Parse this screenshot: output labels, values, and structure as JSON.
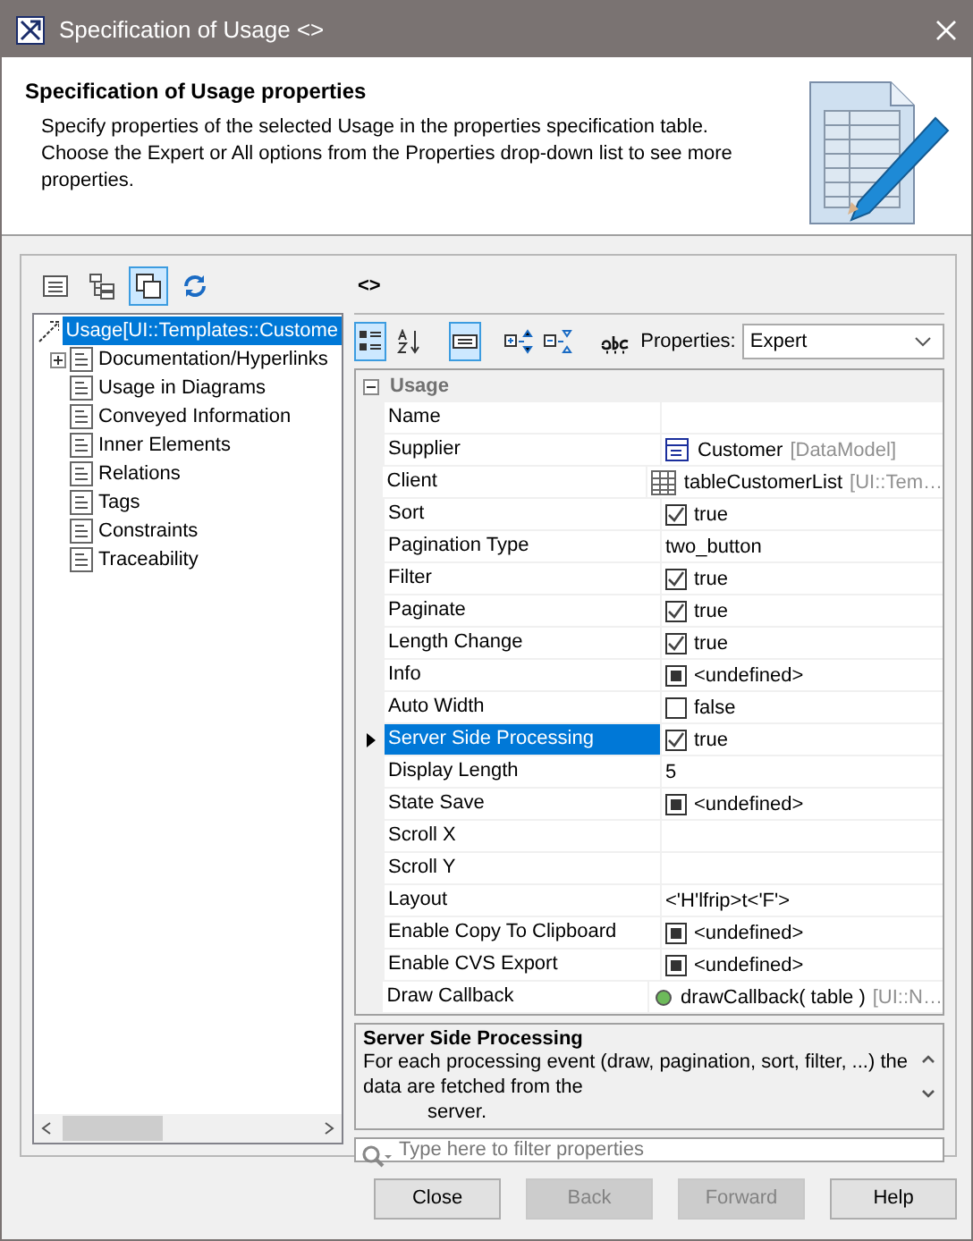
{
  "window": {
    "title": "Specification of Usage <>"
  },
  "header": {
    "title": "Specification of Usage properties",
    "description": "Specify properties of the selected Usage in the properties specification table. Choose the Expert or All options from the Properties drop-down list to see more properties."
  },
  "tree_toolbar": [
    {
      "kind": "list",
      "selected": false
    },
    {
      "kind": "tree",
      "selected": false
    },
    {
      "kind": "copy",
      "selected": true
    },
    {
      "kind": "refresh",
      "selected": false
    }
  ],
  "element_name": "<>",
  "tree": {
    "label": "Usage[UI::Templates::Custome",
    "selected": true,
    "children": [
      {
        "label": "Documentation/Hyperlinks",
        "selected": false,
        "expandable": true,
        "expanded": false
      },
      {
        "label": "Usage in Diagrams",
        "selected": false,
        "expandable": false
      },
      {
        "label": "Conveyed Information",
        "selected": false,
        "expandable": false
      },
      {
        "label": "Inner Elements",
        "selected": false,
        "expandable": false
      },
      {
        "label": "Relations",
        "selected": false,
        "expandable": false
      },
      {
        "label": "Tags",
        "selected": false,
        "expandable": false
      },
      {
        "label": "Constraints",
        "selected": false,
        "expandable": false
      },
      {
        "label": "Traceability",
        "selected": false,
        "expandable": false
      }
    ]
  },
  "grid_toolbar": [
    {
      "kind": "categorized",
      "selected": true
    },
    {
      "kind": "sort",
      "selected": false
    },
    {
      "kind": "description",
      "selected": true
    },
    {
      "kind": "expand",
      "selected": false
    },
    {
      "kind": "collapse",
      "selected": false
    },
    {
      "kind": "spelling",
      "selected": false
    }
  ],
  "properties_filter": {
    "label": "Properties:",
    "value": "Expert"
  },
  "group": {
    "label": "Usage",
    "expanded": true
  },
  "properties": [
    {
      "name": "Name",
      "kind": "text",
      "selected": false
    },
    {
      "name": "Supplier",
      "kind": "class",
      "value": "Customer",
      "secondary": "[DataModel]",
      "selected": false
    },
    {
      "name": "Client",
      "kind": "table",
      "value": "tableCustomerList",
      "secondary": "[UI::Tem…",
      "selected": false
    },
    {
      "name": "Sort",
      "kind": "check",
      "checked": true,
      "value": "true",
      "selected": false
    },
    {
      "name": "Pagination Type",
      "kind": "text",
      "value": "two_button",
      "selected": false
    },
    {
      "name": "Filter",
      "kind": "check",
      "checked": true,
      "value": "true",
      "selected": false
    },
    {
      "name": "Paginate",
      "kind": "check",
      "checked": true,
      "value": "true",
      "selected": false
    },
    {
      "name": "Length Change",
      "kind": "check",
      "checked": true,
      "value": "true",
      "selected": false
    },
    {
      "name": "Info",
      "kind": "undefined",
      "indeterminate": true,
      "value": "<undefined>",
      "selected": false
    },
    {
      "name": "Auto Width",
      "kind": "check",
      "checked": false,
      "value": "false",
      "selected": false
    },
    {
      "name": "Server Side Processing",
      "kind": "check",
      "checked": true,
      "value": "true",
      "selected": true
    },
    {
      "name": "Display Length",
      "kind": "text",
      "value": "5",
      "selected": false
    },
    {
      "name": "State Save",
      "kind": "undefined",
      "indeterminate": true,
      "value": "<undefined>",
      "selected": false
    },
    {
      "name": "Scroll X",
      "kind": "text",
      "selected": false
    },
    {
      "name": "Scroll Y",
      "kind": "text",
      "selected": false
    },
    {
      "name": "Layout",
      "kind": "text",
      "value": "<'H'lfrip>t<'F'>",
      "selected": false
    },
    {
      "name": "Enable Copy To Clipboard",
      "kind": "undefined",
      "indeterminate": true,
      "value": "<undefined>",
      "selected": false
    },
    {
      "name": "Enable CVS Export",
      "kind": "undefined",
      "indeterminate": true,
      "value": "<undefined>",
      "selected": false
    },
    {
      "name": "Draw Callback",
      "kind": "operation",
      "value": "drawCallback( table )",
      "secondary": "[UI::N…",
      "selected": false
    }
  ],
  "description": {
    "title": "Server Side Processing",
    "lines": [
      "For each processing event (draw, pagination, sort, filter, ...) the data are fetched from the",
      "server."
    ]
  },
  "filter": {
    "placeholder": "Type here to filter properties"
  },
  "buttons": [
    {
      "label": "Close",
      "disabled": false
    },
    {
      "label": "Back",
      "disabled": true
    },
    {
      "label": "Forward",
      "disabled": true
    },
    {
      "label": "Help",
      "disabled": false
    }
  ]
}
